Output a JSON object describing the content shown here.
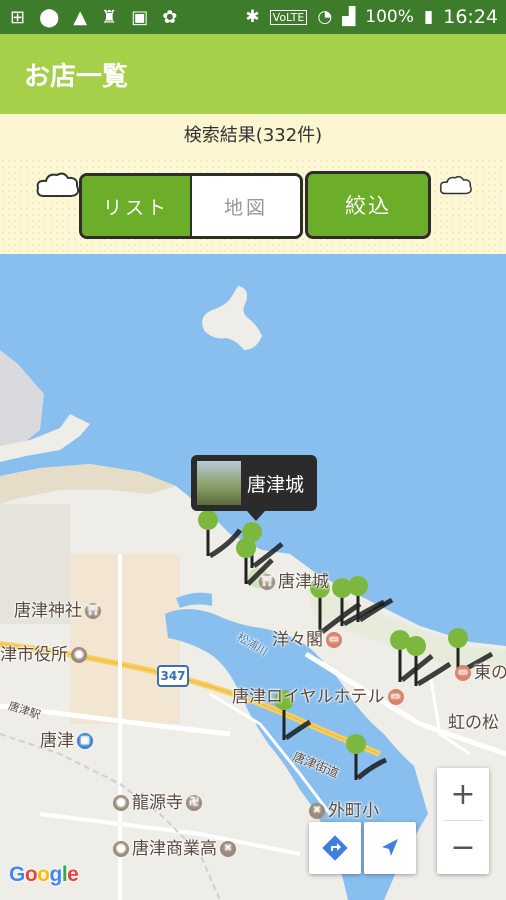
{
  "status_bar": {
    "battery": "100%",
    "time": "16:24"
  },
  "appbar": {
    "title": "お店一覧"
  },
  "result": {
    "text": "検索結果(332件)"
  },
  "filter": {
    "list_label": "リスト",
    "map_label": "地図",
    "narrow_label": "絞込"
  },
  "map": {
    "info_window": {
      "name": "唐津城"
    },
    "highway_number": "347",
    "labels": {
      "karatsu_castle": "唐津城",
      "karatsu_shrine": "唐津神社",
      "city_hall": "津市役所",
      "yoyokaku": "洋々閣",
      "royal_hotel": "唐津ロイヤルホテル",
      "higashi": "東の",
      "niji": "虹の松",
      "station": "唐津",
      "ryugenji": "龍源寺",
      "tomachi": "外町小",
      "commercial_hs": "唐津商業高",
      "matsuura_river": "松浦川",
      "karatsu_kaido": "唐津街道",
      "karatsu_eki_small": "唐津駅"
    },
    "zoom_in": "+",
    "zoom_out": "−",
    "google": [
      "G",
      "o",
      "o",
      "g",
      "l",
      "e"
    ],
    "colors": {
      "water": "#88bfef",
      "land": "#eeede8",
      "pin": "#7cb83e"
    }
  }
}
